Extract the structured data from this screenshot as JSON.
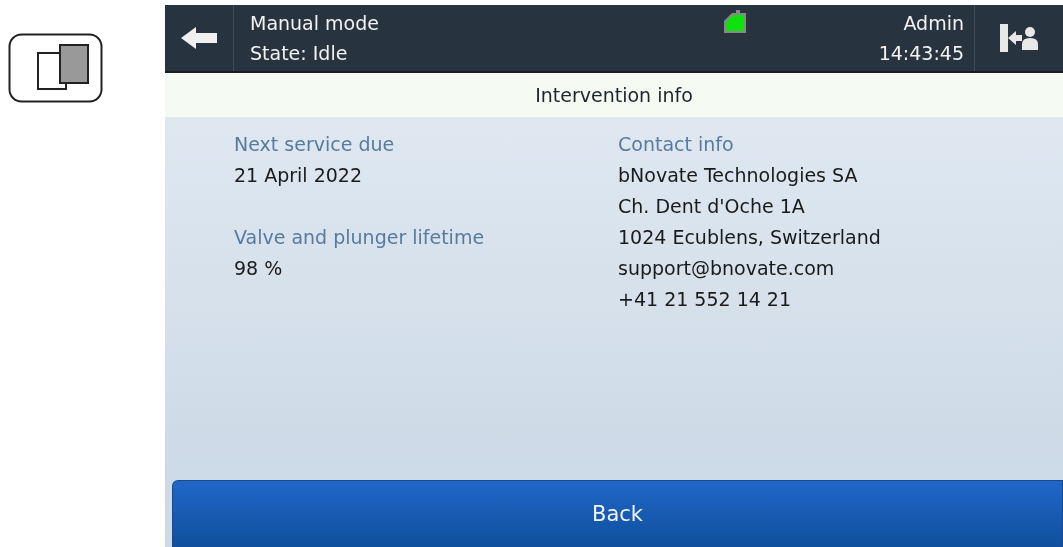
{
  "header": {
    "mode": "Manual mode",
    "state": "State: Idle",
    "user": "Admin",
    "time": "14:43:45"
  },
  "title": "Intervention info",
  "left": [
    {
      "label": "Next service due",
      "value": "21 April 2022"
    },
    {
      "label": "Valve and plunger lifetime",
      "value": "98 %"
    }
  ],
  "contact": {
    "label": "Contact info",
    "lines": [
      "bNovate Technologies SA",
      "Ch. Dent d'Oche 1A",
      "1024 Ecublens, Switzerland",
      "support@bnovate.com",
      "+41 21 552 14 21"
    ]
  },
  "back_button": "Back"
}
